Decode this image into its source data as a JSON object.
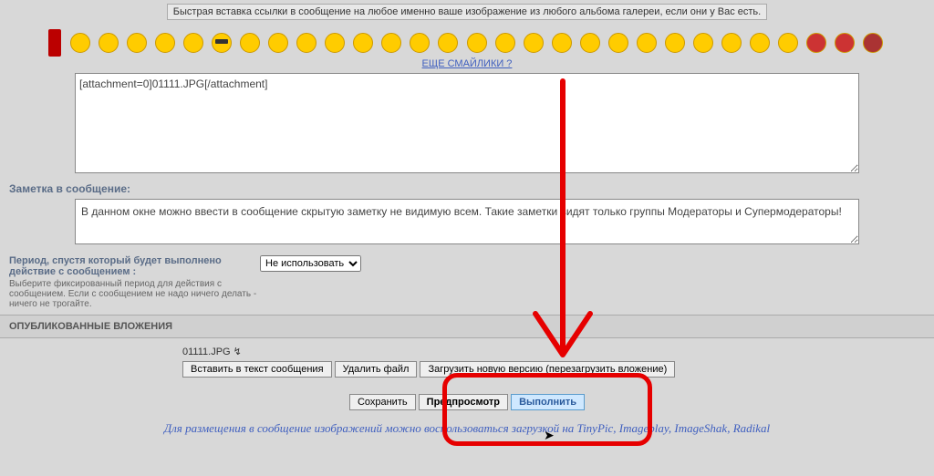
{
  "hint": "Быстрая вставка ссылки в сообщение на любое именно ваше изображение из любого альбома галереи, если они у Вас есть.",
  "more_smilies": "ЕЩЕ СМАЙЛИКИ ?",
  "main_text": "[attachment=0]01111.JPG[/attachment]",
  "note_label": "Заметка в сообщение:",
  "note_text": "В данном окне можно ввести в сообщение скрытую заметку не видимую всем. Такие заметки видят только группы Модераторы и Супермодераторы!",
  "period": {
    "title": "Период, спустя который будет выполнено действие с сообщением :",
    "desc": "Выберите фиксированный период для действия с сообщением. Если с сообщением не надо ничего делать - ничего не трогайте.",
    "selected": "Не использовать"
  },
  "attach": {
    "header": "ОПУБЛИКОВАННЫЕ ВЛОЖЕНИЯ",
    "file": "01111.JPG",
    "arrow": "↯",
    "btn_insert": "Вставить в текст сообщения",
    "btn_delete": "Удалить файл",
    "btn_reload": "Загрузить новую версию (перезагрузить вложение)"
  },
  "buttons": {
    "save": "Сохранить",
    "preview": "Предпросмотр",
    "execute": "Выполнить"
  },
  "footer": "Для размещения в сообщение изображений можно воспользоваться загрузкой на TinyPic, Imageplay, ImageShak, Radikal"
}
